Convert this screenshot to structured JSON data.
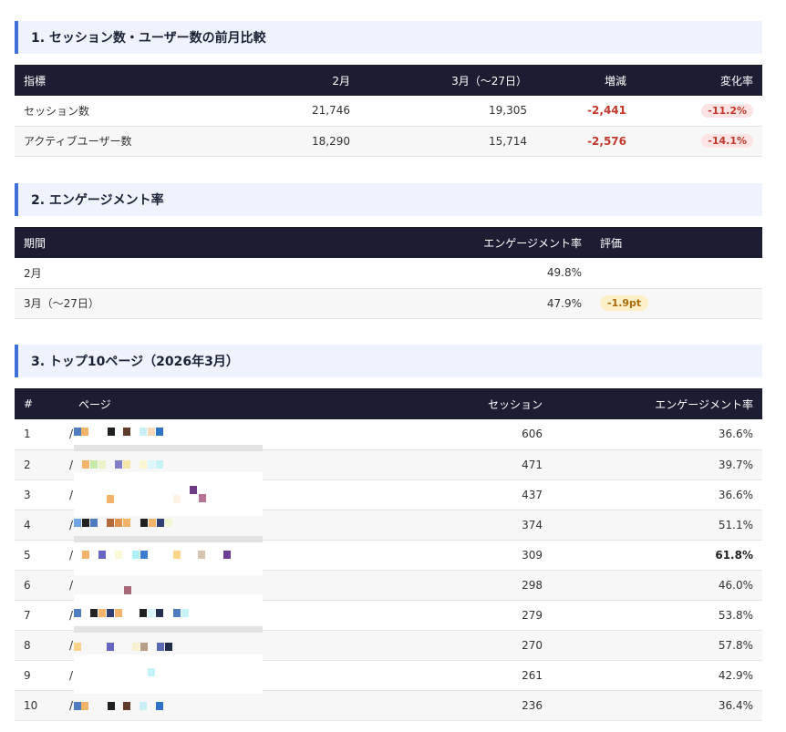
{
  "section1": {
    "title": "1. セッション数・ユーザー数の前月比較",
    "headers": [
      "指標",
      "2月",
      "3月（〜27日）",
      "増減",
      "変化率"
    ],
    "rows": [
      {
        "metric": "セッション数",
        "feb": "21,746",
        "mar": "19,305",
        "diff": "-2,441",
        "rate": "-11.2%"
      },
      {
        "metric": "アクティブユーザー数",
        "feb": "18,290",
        "mar": "15,714",
        "diff": "-2,576",
        "rate": "-14.1%"
      }
    ]
  },
  "section2": {
    "title": "2. エンゲージメント率",
    "headers": [
      "期間",
      "エンゲージメント率",
      "評価"
    ],
    "rows": [
      {
        "period": "2月",
        "rate": "49.8%",
        "eval": ""
      },
      {
        "period": "3月（〜27日）",
        "rate": "47.9%",
        "eval": "-1.9pt"
      }
    ]
  },
  "section3": {
    "title": "3. トップ10ページ（2026年3月）",
    "headers": [
      "#",
      "ページ",
      "セッション",
      "エンゲージメント率"
    ],
    "rows": [
      {
        "rank": "1",
        "page": "/",
        "sessions": "606",
        "rate": "36.6%"
      },
      {
        "rank": "2",
        "page": "/",
        "sessions": "471",
        "rate": "39.7%"
      },
      {
        "rank": "3",
        "page": "/",
        "sessions": "437",
        "rate": "36.6%"
      },
      {
        "rank": "4",
        "page": "/",
        "sessions": "374",
        "rate": "51.1%"
      },
      {
        "rank": "5",
        "page": "/",
        "sessions": "309",
        "rate": "61.8%"
      },
      {
        "rank": "6",
        "page": "/",
        "sessions": "298",
        "rate": "46.0%"
      },
      {
        "rank": "7",
        "page": "/",
        "sessions": "279",
        "rate": "53.8%"
      },
      {
        "rank": "8",
        "page": "/",
        "sessions": "270",
        "rate": "57.8%"
      },
      {
        "rank": "9",
        "page": "/",
        "sessions": "261",
        "rate": "42.9%"
      },
      {
        "rank": "10",
        "page": "/",
        "sessions": "236",
        "rate": "36.4%"
      }
    ]
  },
  "colors": {
    "header_bg": "#1c1d33",
    "section_bg": "#eef3fd",
    "accent": "#3f6fd8",
    "negative": "#c0392b",
    "badge_red_bg": "#fde3e3",
    "badge_amber_bg": "#fdf0c8",
    "badge_amber_text": "#a86a0b"
  }
}
